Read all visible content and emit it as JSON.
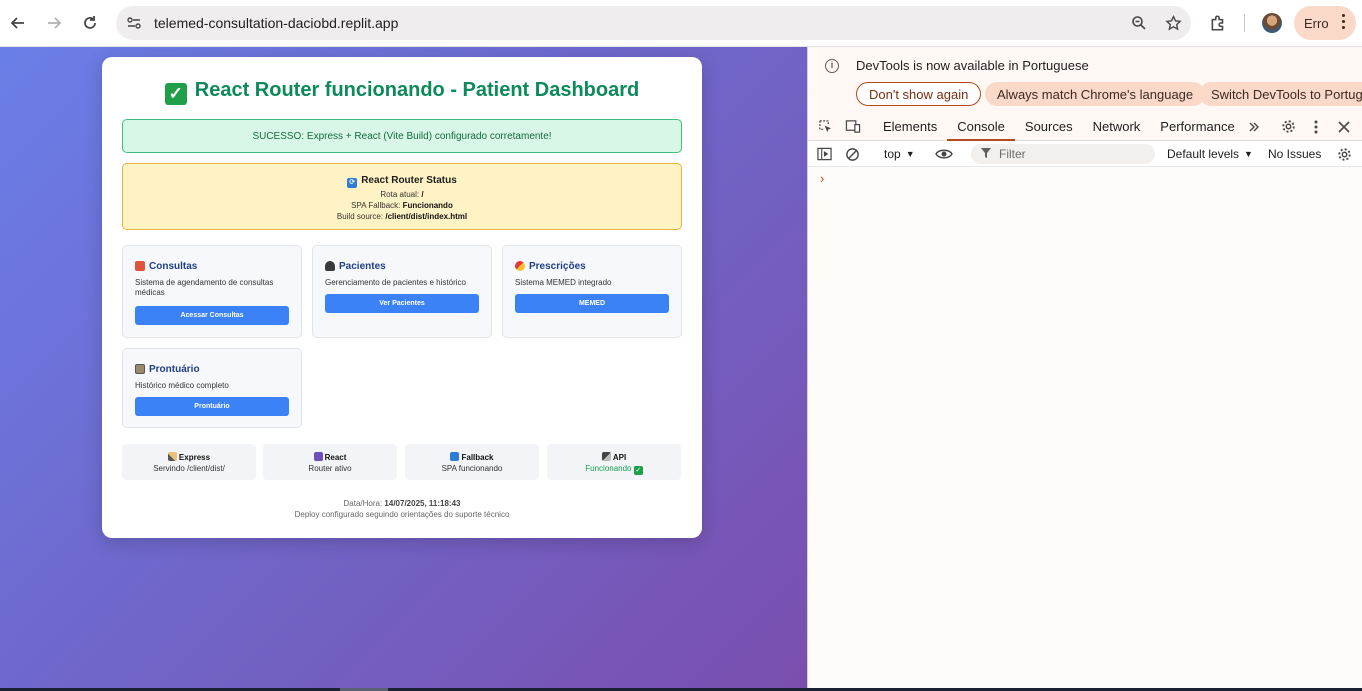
{
  "browser": {
    "url": "telemed-consultation-daciobd.replit.app",
    "profile_label": "Erro",
    "icons": [
      "back-icon",
      "forward-icon",
      "reload-icon",
      "site-info-icon",
      "zoom-icon",
      "star-icon",
      "extensions-icon",
      "menu-icon"
    ]
  },
  "page": {
    "title": "React Router funcionando - Patient Dashboard",
    "success_message": "SUCESSO: Express + React (Vite Build) configurado corretamente!",
    "status": {
      "title": "React Router Status",
      "route_label": "Rota atual:",
      "route_value": "/",
      "fallback_label": "SPA Fallback:",
      "fallback_value": "Funcionando",
      "build_label": "Build source:",
      "build_value": "/client/dist/index.html"
    },
    "features": [
      {
        "title": "Consultas",
        "description": "Sistema de agendamento de consultas médicas",
        "button": "Acessar Consultas"
      },
      {
        "title": "Pacientes",
        "description": "Gerenciamento de pacientes e histórico",
        "button": "Ver Pacientes"
      },
      {
        "title": "Prescrições",
        "description": "Sistema MEMED integrado",
        "button": "MEMED"
      },
      {
        "title": "Prontuário",
        "description": "Histórico médico completo",
        "button": "Prontuário"
      }
    ],
    "stats": [
      {
        "title": "Express",
        "subtitle": "Servindo /client/dist/"
      },
      {
        "title": "React",
        "subtitle": "Router ativo"
      },
      {
        "title": "Fallback",
        "subtitle": "SPA funcionando"
      },
      {
        "title": "API",
        "subtitle": "Funcionando"
      }
    ],
    "footer": {
      "datetime_label": "Data/Hora:",
      "datetime_value": "14/07/2025, 11:18:43",
      "note": "Deploy configurado seguindo orientações do suporte técnico"
    }
  },
  "devtools": {
    "banner_message": "DevTools is now available in Portuguese",
    "banner_buttons": [
      "Don't show again",
      "Always match Chrome's language",
      "Switch DevTools to Portuguese"
    ],
    "tabs": [
      "Elements",
      "Console",
      "Sources",
      "Network",
      "Performance"
    ],
    "active_tab": "Console",
    "context": "top",
    "filter_placeholder": "Filter",
    "levels": "Default levels",
    "issues": "No Issues",
    "prompt": "›"
  },
  "colors": {
    "accent": "#3b82f6",
    "title_green": "#0d8a5a",
    "devtools_accent": "#b24a1c"
  }
}
